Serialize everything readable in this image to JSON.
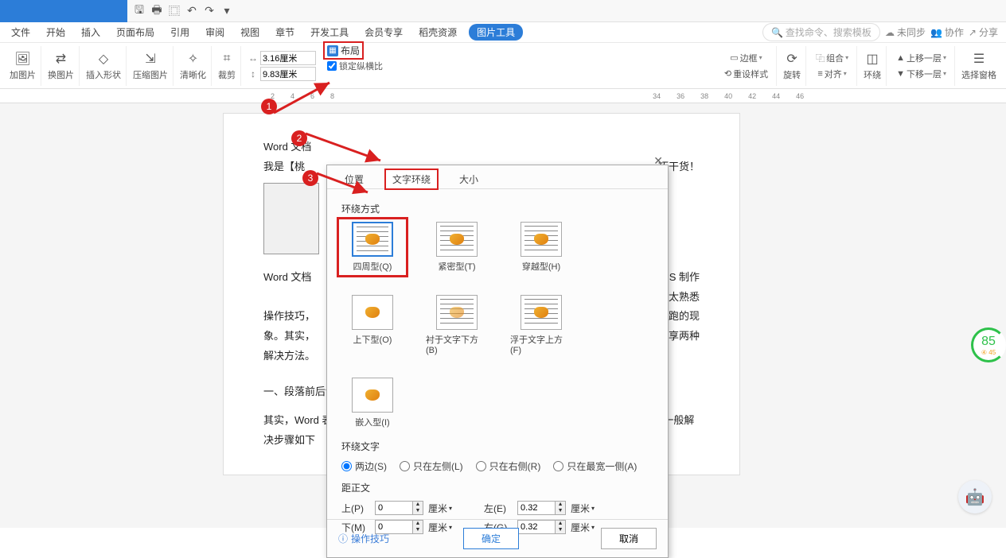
{
  "menu": {
    "file": "文件",
    "hints": [
      "开始",
      "插入",
      "页面布局",
      "引用",
      "审阅",
      "视图",
      "章节",
      "开发工具",
      "会员专享",
      "稻壳资源"
    ],
    "pic_tool": "图片工具",
    "search_ph": "查找命令、搜索模板",
    "unsynced": "未同步",
    "collab": "协作",
    "share": "分享"
  },
  "ribbon": {
    "add_pic": "加图片",
    "change_pic": "换图片",
    "insert_shape": "插入形状",
    "compress": "压缩图片",
    "sharpen": "清晰化",
    "crop": "裁剪",
    "width_val": "3.16厘米",
    "height_val": "9.83厘米",
    "lock_ratio": "锁定纵横比",
    "layout": "布局",
    "border": "边框",
    "reset_style": "重设样式",
    "rotate": "旋转",
    "group": "组合",
    "align": "对齐",
    "wrap": "环绕",
    "up_layer": "上移一层",
    "down_layer": "下移一层",
    "sel_pane": "选择窗格"
  },
  "ruler_marks": [
    "2",
    "4",
    "6",
    "8",
    "34",
    "36",
    "38",
    "40",
    "42",
    "44",
    "46"
  ],
  "dialog": {
    "tabs": {
      "pos": "位置",
      "wrap": "文字环绕",
      "size": "大小"
    },
    "section_wrap": "环绕方式",
    "opts": {
      "square": "四周型(Q)",
      "tight": "紧密型(T)",
      "through": "穿越型(H)",
      "topbot": "上下型(O)",
      "behind": "衬于文字下方(B)",
      "front": "浮于文字上方(F)",
      "inline": "嵌入型(I)"
    },
    "section_text": "环绕文字",
    "radios": {
      "both": "两边(S)",
      "left": "只在左侧(L)",
      "right": "只在右侧(R)",
      "widest": "只在最宽一侧(A)"
    },
    "section_dist": "距正文",
    "dist": {
      "top": "上(P)",
      "bottom": "下(M)",
      "left": "左(E)",
      "right": "右(G)"
    },
    "dist_vals": {
      "top": "0",
      "bottom": "0",
      "left": "0.32",
      "right": "0.32"
    },
    "unit": "厘米",
    "tips": "操作技巧",
    "ok": "确定",
    "cancel": "取消"
  },
  "doc": {
    "title": "Word 文档",
    "line1_a": "我是【桃",
    "line1_b": "巧干货！",
    "para2_a": "Word 文档",
    "para2_b": "PS 制作",
    "para2_c": "不太熟悉",
    "para2_d": "操作技巧，",
    "para2_e": "乱跑的现",
    "para2_f": "象。其实，",
    "para2_g": "分享两种",
    "para2_h": "解决方法。",
    "h2": "一、段落前后设置了间距",
    "para3": "其实，Word 表格行高无法调整比较常见的原因就是在段落前后设置了间距，这种情况下一般解决步骤如下"
  },
  "score": {
    "val": "85",
    "sub": "④ 45"
  },
  "markers": {
    "m1": "1",
    "m2": "2",
    "m3": "3"
  }
}
